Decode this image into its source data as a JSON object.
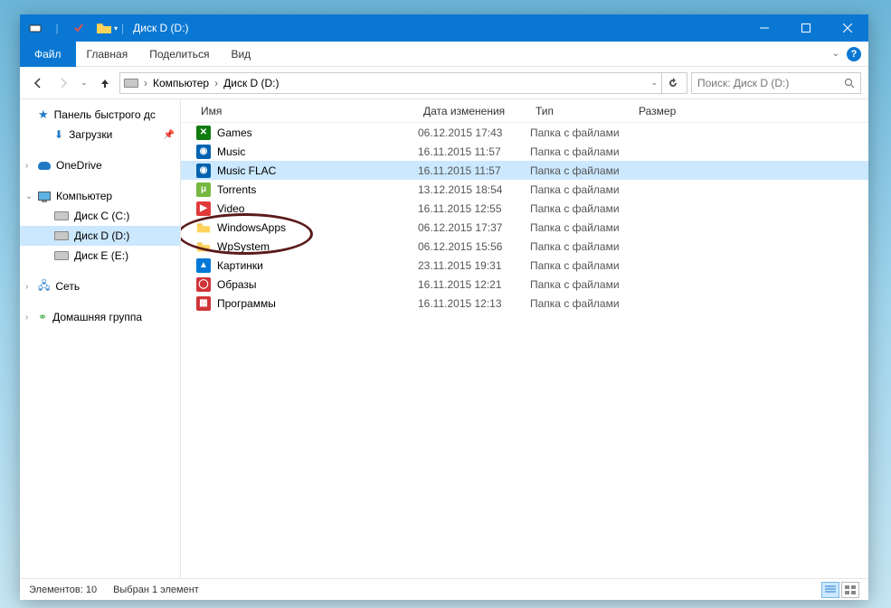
{
  "window": {
    "title": "Диск D (D:)"
  },
  "ribbon": {
    "file": "Файл",
    "tabs": [
      "Главная",
      "Поделиться",
      "Вид"
    ]
  },
  "breadcrumb": {
    "items": [
      "Компьютер",
      "Диск D (D:)"
    ]
  },
  "search": {
    "placeholder": "Поиск: Диск D (D:)"
  },
  "sidebar": {
    "quick_access": "Панель быстрого дс",
    "downloads": "Загрузки",
    "onedrive": "OneDrive",
    "computer": "Компьютер",
    "drives": [
      {
        "label": "Диск C (C:)"
      },
      {
        "label": "Диск D (D:)",
        "selected": true
      },
      {
        "label": "Диск E (E:)"
      }
    ],
    "network": "Сеть",
    "homegroup": "Домашняя группа"
  },
  "columns": {
    "name": "Имя",
    "date": "Дата изменения",
    "type": "Тип",
    "size": "Размер"
  },
  "items": [
    {
      "name": "Games",
      "date": "06.12.2015 17:43",
      "type": "Папка с файлами",
      "icon": "xbox",
      "selected": false
    },
    {
      "name": "Music",
      "date": "16.11.2015 11:57",
      "type": "Папка с файлами",
      "icon": "groove",
      "selected": false
    },
    {
      "name": "Music FLAC",
      "date": "16.11.2015 11:57",
      "type": "Папка с файлами",
      "icon": "groove",
      "selected": true
    },
    {
      "name": "Torrents",
      "date": "13.12.2015 18:54",
      "type": "Папка с файлами",
      "icon": "utorrent",
      "selected": false
    },
    {
      "name": "Video",
      "date": "16.11.2015 12:55",
      "type": "Папка с файлами",
      "icon": "movies",
      "selected": false
    },
    {
      "name": "WindowsApps",
      "date": "06.12.2015 17:37",
      "type": "Папка с файлами",
      "icon": "folder",
      "selected": false
    },
    {
      "name": "WpSystem",
      "date": "06.12.2015 15:56",
      "type": "Папка с файлами",
      "icon": "folder",
      "selected": false
    },
    {
      "name": "Картинки",
      "date": "23.11.2015 19:31",
      "type": "Папка с файлами",
      "icon": "photos",
      "selected": false
    },
    {
      "name": "Образы",
      "date": "16.11.2015 12:21",
      "type": "Папка с файлами",
      "icon": "iso",
      "selected": false
    },
    {
      "name": "Программы",
      "date": "16.11.2015 12:13",
      "type": "Папка с файлами",
      "icon": "apps",
      "selected": false
    }
  ],
  "status": {
    "count": "Элементов: 10",
    "selection": "Выбран 1 элемент"
  },
  "icon_colors": {
    "xbox": "#107c10",
    "groove": "#0063b1",
    "utorrent": "#76b83f",
    "movies": "#e03a3a",
    "folder": "#ffd45c",
    "photos": "#0078d7",
    "iso": "#d03438",
    "apps": "#d03438"
  }
}
